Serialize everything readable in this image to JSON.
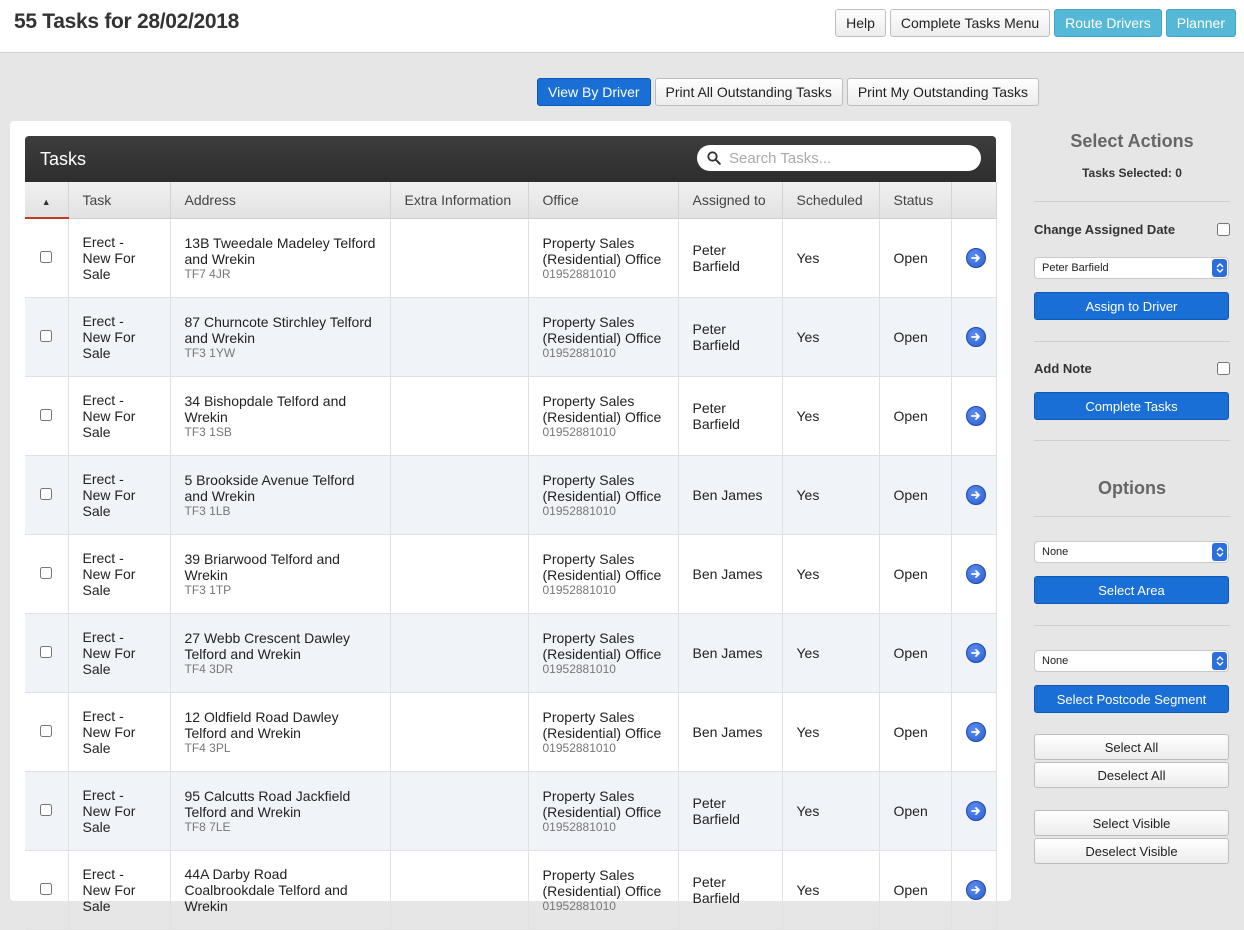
{
  "page": {
    "title": "55 Tasks for 28/02/2018"
  },
  "top_buttons": {
    "help": "Help",
    "complete_menu": "Complete Tasks Menu",
    "route_drivers": "Route Drivers",
    "planner": "Planner"
  },
  "view_buttons": {
    "by_driver": "View By Driver",
    "print_all": "Print All Outstanding Tasks",
    "print_my": "Print My Outstanding Tasks"
  },
  "tasks_panel": {
    "title": "Tasks",
    "search_placeholder": "Search Tasks..."
  },
  "table": {
    "headers": {
      "task": "Task",
      "address": "Address",
      "extra": "Extra Information",
      "office": "Office",
      "assigned": "Assigned to",
      "scheduled": "Scheduled",
      "status": "Status"
    },
    "rows": [
      {
        "task": "Erect - New For Sale",
        "address": "13B Tweedale Madeley Telford and Wrekin",
        "postcode": "TF7 4JR",
        "office": "Property Sales (Residential) Office",
        "phone": "01952881010",
        "assigned": "Peter Barfield",
        "scheduled": "Yes",
        "status": "Open"
      },
      {
        "task": "Erect - New For Sale",
        "address": "87 Churncote Stirchley Telford and Wrekin",
        "postcode": "TF3 1YW",
        "office": "Property Sales (Residential) Office",
        "phone": "01952881010",
        "assigned": "Peter Barfield",
        "scheduled": "Yes",
        "status": "Open"
      },
      {
        "task": "Erect - New For Sale",
        "address": "34 Bishopdale Telford and Wrekin",
        "postcode": "TF3 1SB",
        "office": "Property Sales (Residential) Office",
        "phone": "01952881010",
        "assigned": "Peter Barfield",
        "scheduled": "Yes",
        "status": "Open"
      },
      {
        "task": "Erect - New For Sale",
        "address": "5 Brookside Avenue Telford and Wrekin",
        "postcode": "TF3 1LB",
        "office": "Property Sales (Residential) Office",
        "phone": "01952881010",
        "assigned": "Ben James",
        "scheduled": "Yes",
        "status": "Open"
      },
      {
        "task": "Erect - New For Sale",
        "address": "39 Briarwood Telford and Wrekin",
        "postcode": "TF3 1TP",
        "office": "Property Sales (Residential) Office",
        "phone": "01952881010",
        "assigned": "Ben James",
        "scheduled": "Yes",
        "status": "Open"
      },
      {
        "task": "Erect - New For Sale",
        "address": "27 Webb Crescent Dawley Telford and Wrekin",
        "postcode": "TF4 3DR",
        "office": "Property Sales (Residential) Office",
        "phone": "01952881010",
        "assigned": "Ben James",
        "scheduled": "Yes",
        "status": "Open"
      },
      {
        "task": "Erect - New For Sale",
        "address": "12 Oldfield Road Dawley Telford and Wrekin",
        "postcode": "TF4 3PL",
        "office": "Property Sales (Residential) Office",
        "phone": "01952881010",
        "assigned": "Ben James",
        "scheduled": "Yes",
        "status": "Open"
      },
      {
        "task": "Erect - New For Sale",
        "address": "95 Calcutts Road Jackfield Telford and Wrekin",
        "postcode": "TF8 7LE",
        "office": "Property Sales (Residential) Office",
        "phone": "01952881010",
        "assigned": "Peter Barfield",
        "scheduled": "Yes",
        "status": "Open"
      },
      {
        "task": "Erect - New For Sale",
        "address": "44A Darby Road Coalbrookdale Telford and Wrekin",
        "postcode": "",
        "office": "Property Sales (Residential) Office",
        "phone": "01952881010",
        "assigned": "Peter Barfield",
        "scheduled": "Yes",
        "status": "Open"
      }
    ]
  },
  "sidebar": {
    "select_actions": "Select Actions",
    "tasks_selected": "Tasks Selected: 0",
    "change_date_label": "Change Assigned Date",
    "driver_select": "Peter Barfield",
    "assign_btn": "Assign to Driver",
    "add_note_label": "Add Note",
    "complete_btn": "Complete Tasks",
    "options": "Options",
    "area_select": "None",
    "select_area_btn": "Select Area",
    "postcode_select": "None",
    "select_postcode_btn": "Select Postcode Segment",
    "select_all": "Select All",
    "deselect_all": "Deselect All",
    "select_visible": "Select Visible",
    "deselect_visible": "Deselect Visible"
  }
}
